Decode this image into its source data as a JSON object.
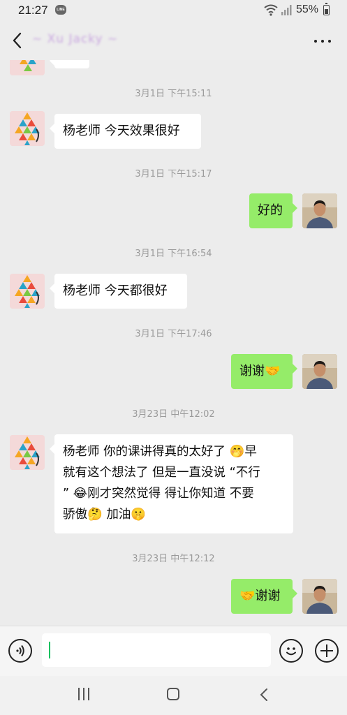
{
  "status_bar": {
    "time": "21:27",
    "line_badge": "LINE",
    "battery_percent": "55%",
    "battery_level": 0.55
  },
  "header": {
    "contact_name": "~ Xu Jacky ~"
  },
  "icons": {
    "back": "chevron-left-icon",
    "more": "more-horizontal-icon",
    "voice": "voice-icon",
    "emoji": "emoji-icon",
    "plus": "plus-icon"
  },
  "colors": {
    "bubble_out": "#95ec69",
    "bubble_in": "#ffffff",
    "background": "#ececec",
    "caret": "#07c160"
  },
  "messages": [
    {
      "type": "timestamp",
      "text": "3月1日 下午15:11"
    },
    {
      "type": "incoming",
      "text": "杨老师 今天效果很好"
    },
    {
      "type": "timestamp",
      "text": "3月1日 下午15:17"
    },
    {
      "type": "outgoing",
      "text": "好的"
    },
    {
      "type": "timestamp",
      "text": "3月1日 下午16:54"
    },
    {
      "type": "incoming",
      "text": "杨老师 今天都很好"
    },
    {
      "type": "timestamp",
      "text": "3月1日 下午17:46"
    },
    {
      "type": "outgoing",
      "text": "谢谢🤝"
    },
    {
      "type": "timestamp",
      "text": "3月23日 中午12:02"
    },
    {
      "type": "incoming",
      "lines": [
        "杨老师 你的课讲得真的太好了 🤭早",
        "就有这个想法了 但是一直没说 “不行",
        "” 😂刚才突然觉得 得让你知道 不要",
        "骄傲🤔 加油🤫"
      ]
    },
    {
      "type": "timestamp",
      "text": "3月23日 中午12:12"
    },
    {
      "type": "outgoing",
      "text": "🤝谢谢"
    }
  ],
  "input": {
    "value": ""
  }
}
